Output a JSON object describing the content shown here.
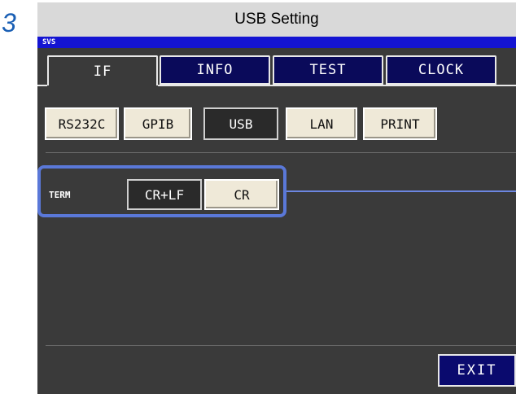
{
  "step": {
    "number": "3"
  },
  "header": {
    "title": "USB Setting"
  },
  "screen": {
    "mode_label": "SVS",
    "tabs": [
      {
        "label": "IF",
        "active": true
      },
      {
        "label": "INFO",
        "active": false
      },
      {
        "label": "TEST",
        "active": false
      },
      {
        "label": "CLOCK",
        "active": false
      }
    ],
    "interfaces": [
      {
        "label": "RS232C",
        "selected": false
      },
      {
        "label": "GPIB",
        "selected": false
      },
      {
        "label": "USB",
        "selected": true
      },
      {
        "label": "LAN",
        "selected": false
      },
      {
        "label": "PRINT",
        "selected": false
      }
    ],
    "term": {
      "label": "TERM",
      "options": [
        {
          "label": "CR+LF",
          "selected": true
        },
        {
          "label": "CR",
          "selected": false
        }
      ]
    },
    "exit_label": "EXIT"
  },
  "colors": {
    "step_number": "#1a5fb4",
    "svs_bar": "#1414d2",
    "tab_inactive": "#0a0a5a",
    "screen_bg": "#3a3a3a",
    "highlight": "#5a78d8"
  }
}
